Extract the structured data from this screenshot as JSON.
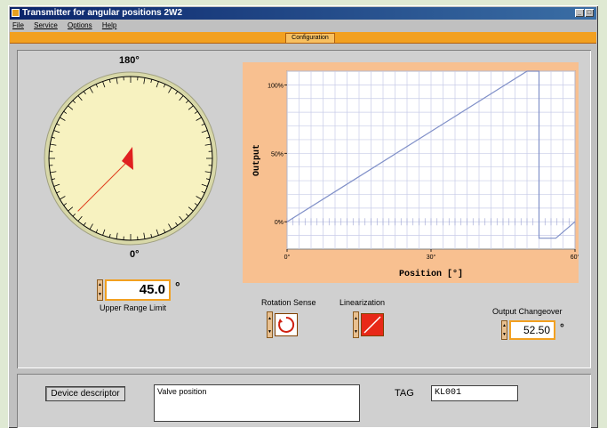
{
  "window": {
    "title": "Transmitter for angular positions 2W2",
    "controls": [
      "_",
      "□"
    ]
  },
  "menu": [
    "File",
    "Service",
    "Options",
    "Help"
  ],
  "tab": {
    "label": "Configuration"
  },
  "dial": {
    "top_label": "180°",
    "bottom_label": "0°",
    "face_color": "#f7f2c0",
    "needle_angle_deg": 45.0
  },
  "upper_range_limit": {
    "value": "45.0",
    "unit": "°",
    "label": "Upper Range Limit"
  },
  "chart_data": {
    "type": "line",
    "xlabel": "Position [°]",
    "ylabel": "Output",
    "x_ticks": [
      "0°",
      "30°",
      "60°"
    ],
    "y_ticks": [
      "0%",
      "50%",
      "100%"
    ],
    "xlim": [
      0,
      60
    ],
    "ylim": [
      -20,
      110
    ],
    "grid": true,
    "background": "#f8c090",
    "line_color": "#8090c8",
    "series": [
      {
        "x": [
          0,
          50,
          52.5,
          52.5,
          56,
          60
        ],
        "y": [
          0,
          110,
          110,
          -12,
          -12,
          0
        ]
      }
    ]
  },
  "rotation_sense": {
    "label": "Rotation Sense",
    "icon": "rotation-icon"
  },
  "linearization": {
    "label": "Linearization",
    "icon": "linear-ramp-icon"
  },
  "output_changeover": {
    "label": "Output Changeover",
    "value": "52.50",
    "unit": "°"
  },
  "device_descriptor": {
    "label": "Device descriptor",
    "value": "Valve position"
  },
  "tag": {
    "label": "TAG",
    "value": "KL001"
  }
}
